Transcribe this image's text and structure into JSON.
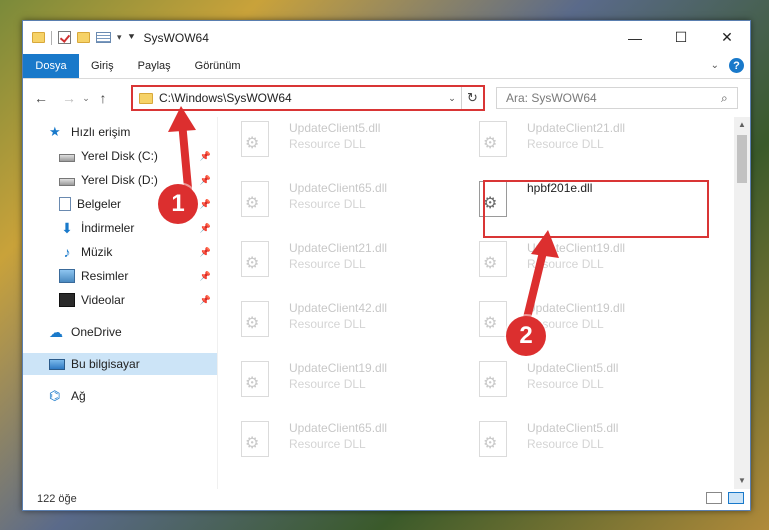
{
  "window": {
    "title": "SysWOW64",
    "controls": {
      "minimize": "—",
      "maximize": "☐",
      "close": "✕"
    }
  },
  "ribbon": {
    "tabs": [
      {
        "label": "Dosya",
        "active": true
      },
      {
        "label": "Giriş"
      },
      {
        "label": "Paylaş"
      },
      {
        "label": "Görünüm"
      }
    ],
    "help": "?"
  },
  "address": {
    "path": "C:\\Windows\\SysWOW64",
    "search_placeholder": "Ara: SysWOW64"
  },
  "navigation": {
    "items": [
      {
        "label": "Hızlı erişim",
        "icon": "star-icon"
      },
      {
        "label": "Yerel Disk (C:)",
        "icon": "drive-icon",
        "pinned": true
      },
      {
        "label": "Yerel Disk (D:)",
        "icon": "drive-icon",
        "pinned": true
      },
      {
        "label": "Belgeler",
        "icon": "documents-icon",
        "pinned": true
      },
      {
        "label": "İndirmeler",
        "icon": "download-icon",
        "pinned": true
      },
      {
        "label": "Müzik",
        "icon": "music-icon",
        "pinned": true
      },
      {
        "label": "Resimler",
        "icon": "pictures-icon",
        "pinned": true
      },
      {
        "label": "Videolar",
        "icon": "videos-icon",
        "pinned": true
      },
      {
        "label": "OneDrive",
        "icon": "cloud-icon"
      },
      {
        "label": "Bu bilgisayar",
        "icon": "computer-icon",
        "selected": true
      },
      {
        "label": "Ağ",
        "icon": "network-icon"
      }
    ]
  },
  "files": [
    {
      "name": "UpdateClient5.dll",
      "type": "Resource DLL"
    },
    {
      "name": "UpdateClient21.dll",
      "type": "Resource DLL"
    },
    {
      "name": "UpdateClient65.dll",
      "type": "Resource DLL"
    },
    {
      "name": "hpbf201e.dll",
      "type": "",
      "highlighted": true
    },
    {
      "name": "UpdateClient21.dll",
      "type": "Resource DLL"
    },
    {
      "name": "UpdateClient19.dll",
      "type": "Resource DLL"
    },
    {
      "name": "UpdateClient42.dll",
      "type": "Resource DLL"
    },
    {
      "name": "UpdateClient19.dll",
      "type": "Resource DLL"
    },
    {
      "name": "UpdateClient19.dll",
      "type": "Resource DLL"
    },
    {
      "name": "UpdateClient5.dll",
      "type": "Resource DLL"
    },
    {
      "name": "UpdateClient65.dll",
      "type": "Resource DLL"
    },
    {
      "name": "UpdateClient5.dll",
      "type": "Resource DLL"
    }
  ],
  "status": {
    "item_count": "122 öğe"
  },
  "annotations": [
    {
      "label": "1"
    },
    {
      "label": "2"
    }
  ],
  "colors": {
    "accent": "#1979ca",
    "annotation": "#dc2f2f"
  }
}
